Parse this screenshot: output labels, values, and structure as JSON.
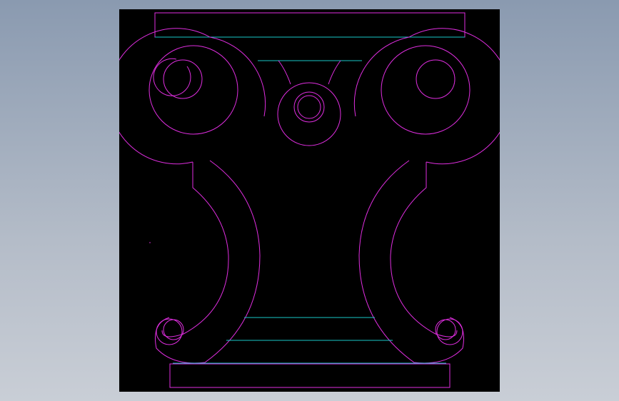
{
  "viewport": {
    "background": "#000000",
    "line_colors": {
      "primary": "#e02ee0",
      "secondary": "#19c8c8"
    }
  },
  "drawing": {
    "subject": "bracket-ornament",
    "parts": [
      "top-plinth",
      "left-volute",
      "right-volute",
      "center-rosette",
      "scroll-legs",
      "base-plinth"
    ]
  }
}
